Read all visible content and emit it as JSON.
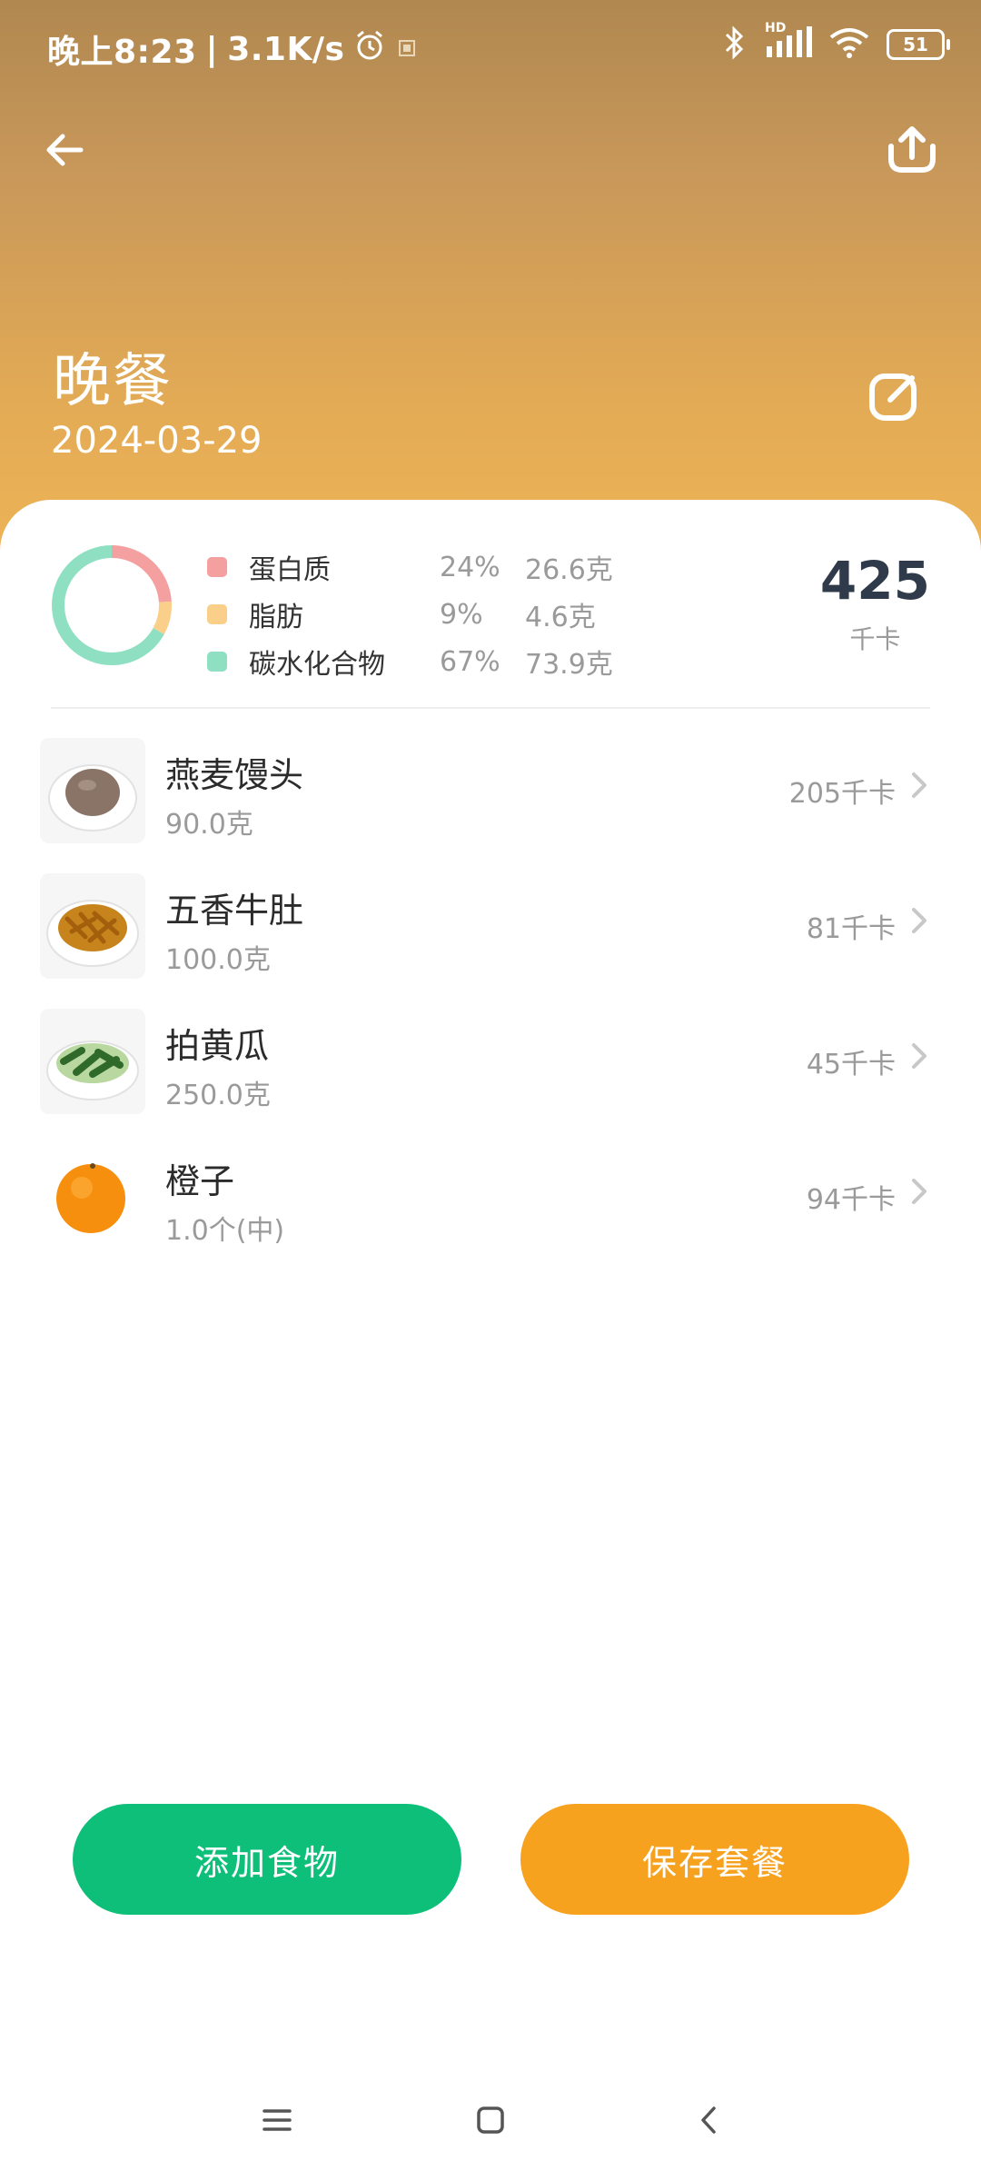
{
  "status_bar": {
    "time_text": "晚上8:23",
    "separator": "|",
    "speed": "3.1K/s",
    "hd_label": "HD",
    "battery": "51"
  },
  "header": {
    "title": "晚餐",
    "date": "2024-03-29"
  },
  "summary": {
    "nutrients": [
      {
        "name": "蛋白质",
        "percent": "24%",
        "grams": "26.6克",
        "color": "#f4a0a0",
        "share": 0.24
      },
      {
        "name": "脂肪",
        "percent": "9%",
        "grams": "4.6克",
        "color": "#f9cf8a",
        "share": 0.09
      },
      {
        "name": "碳水化合物",
        "percent": "67%",
        "grams": "73.9克",
        "color": "#8fe0c3",
        "share": 0.67
      }
    ],
    "total_kcal": "425",
    "kcal_unit": "千卡"
  },
  "foods": [
    {
      "name": "燕麦馒头",
      "amount": "90.0克",
      "kcal": "205千卡",
      "icon": "oat-bun-image"
    },
    {
      "name": "五香牛肚",
      "amount": "100.0克",
      "kcal": "81千卡",
      "icon": "beef-tripe-image"
    },
    {
      "name": "拍黄瓜",
      "amount": "250.0克",
      "kcal": "45千卡",
      "icon": "cucumber-salad-image"
    },
    {
      "name": "橙子",
      "amount": "1.0个(中)",
      "kcal": "94千卡",
      "icon": "orange-image"
    }
  ],
  "actions": {
    "add_food": "添加食物",
    "save_set": "保存套餐"
  },
  "colors": {
    "add_button": "#0dbf78",
    "save_button": "#f7a21e",
    "header_gradient_top": "#b08850",
    "header_gradient_bottom": "#efb457"
  }
}
